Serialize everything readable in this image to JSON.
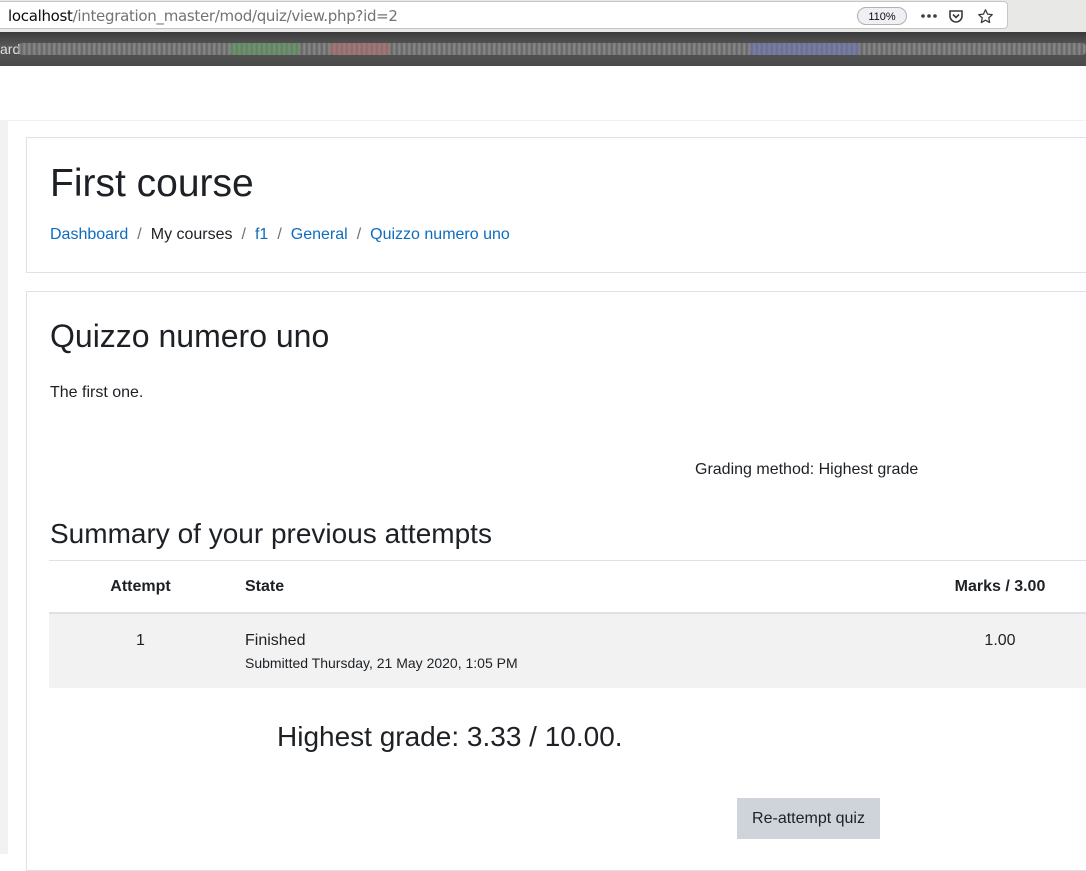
{
  "browser": {
    "url_host": "localhost",
    "url_path": "/integration_master/mod/quiz/view.php?id=2",
    "zoom": "110%",
    "bookmarks_label": "ard"
  },
  "course": {
    "title": "First course",
    "breadcrumb": [
      "Dashboard",
      "My courses",
      "f1",
      "General",
      "Quizzo numero uno"
    ]
  },
  "quiz": {
    "title": "Quizzo numero uno",
    "intro": "The first one.",
    "grading_method": "Grading method: Highest grade",
    "summary_heading": "Summary of your previous attempts",
    "table": {
      "headers": [
        "Attempt",
        "State",
        "Marks / 3.00"
      ],
      "rows": [
        {
          "attempt": "1",
          "state": "Finished",
          "submitted": "Submitted Thursday, 21 May 2020, 1:05 PM",
          "marks": "1.00"
        }
      ]
    },
    "highest_grade": "Highest grade: 3.33 / 10.00.",
    "reattempt_label": "Re-attempt quiz"
  },
  "icons": {
    "more": "more-icon",
    "pocket": "pocket-icon",
    "bookmark": "star-icon"
  },
  "colors": {
    "link": "#0f6cbf",
    "text": "#1d2125",
    "button_bg": "#ced4da",
    "row_bg": "#f2f2f2"
  }
}
